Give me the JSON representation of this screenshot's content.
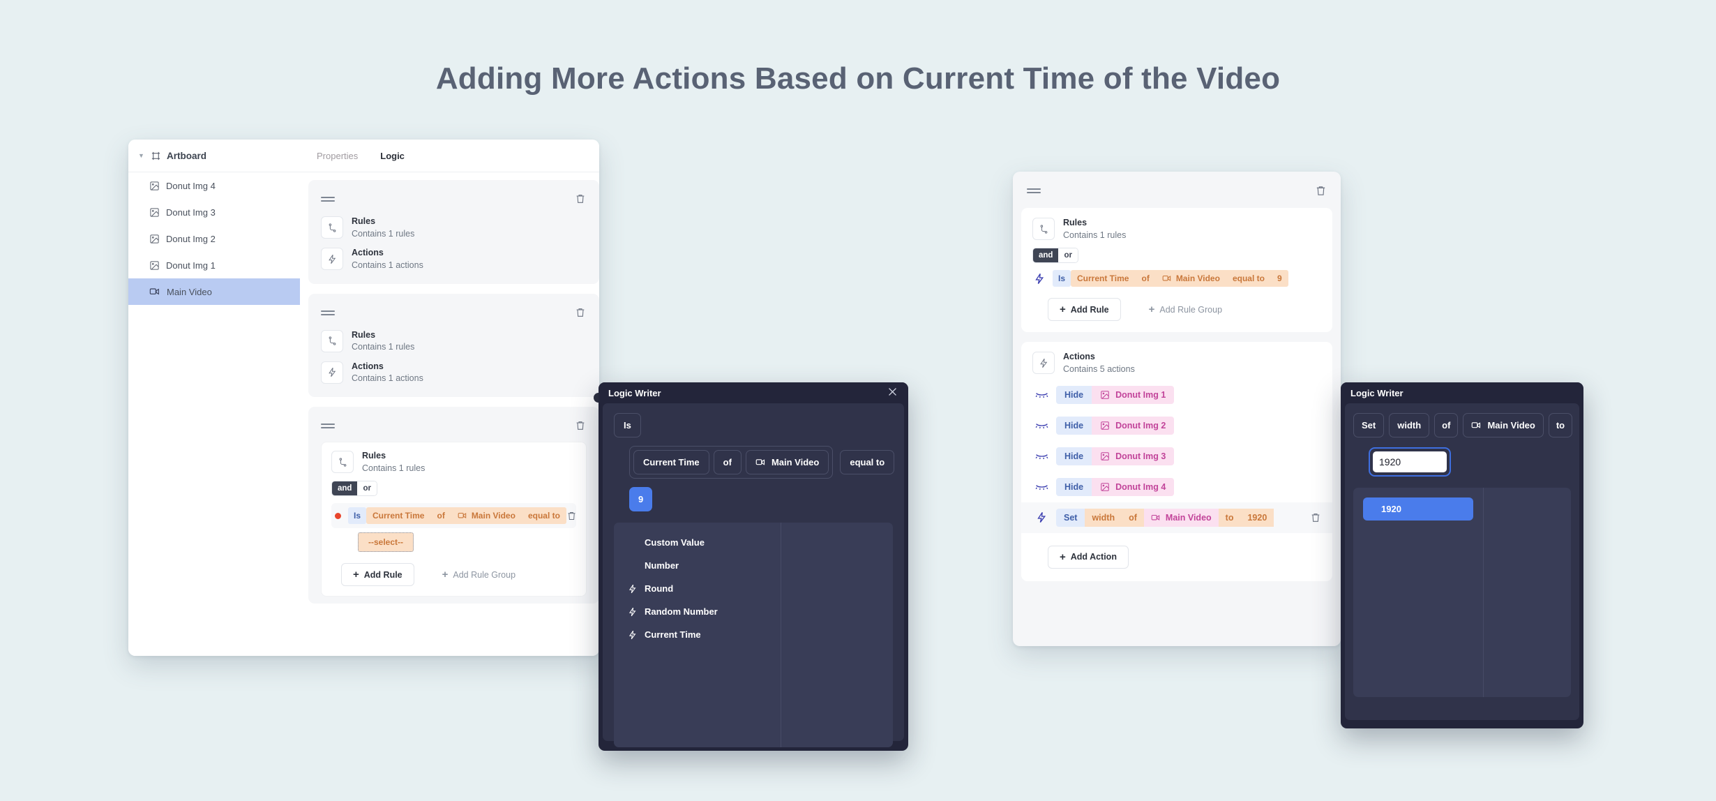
{
  "page": {
    "title": "Adding More Actions Based on Current Time of the Video",
    "background_color": "#e7f0f2",
    "title_color": "#596274"
  },
  "left_app": {
    "tree": {
      "header_label": "Artboard",
      "items": [
        {
          "label": "Donut Img 4",
          "icon": "image-icon",
          "selected": false
        },
        {
          "label": "Donut Img 3",
          "icon": "image-icon",
          "selected": false
        },
        {
          "label": "Donut Img 2",
          "icon": "image-icon",
          "selected": false
        },
        {
          "label": "Donut Img 1",
          "icon": "image-icon",
          "selected": false
        },
        {
          "label": "Main Video",
          "icon": "video-icon",
          "selected": true
        }
      ]
    },
    "tabs": [
      {
        "label": "Properties",
        "active": false
      },
      {
        "label": "Logic",
        "active": true
      }
    ],
    "cards": [
      {
        "rules_title": "Rules",
        "rules_sub": "Contains 1 rules",
        "actions_title": "Actions",
        "actions_sub": "Contains 1 actions"
      },
      {
        "rules_title": "Rules",
        "rules_sub": "Contains 1 rules",
        "actions_title": "Actions",
        "actions_sub": "Contains 1 actions"
      }
    ],
    "expanded_card": {
      "rules_title": "Rules",
      "rules_sub": "Contains 1 rules",
      "operator_and": "and",
      "operator_or": "or",
      "rule": {
        "is": "Is",
        "property": "Current Time",
        "of": "of",
        "target": "Main Video",
        "comparator": "equal to",
        "value_placeholder": "--select--"
      },
      "add_rule": "Add Rule",
      "add_rule_group": "Add Rule Group"
    }
  },
  "right_app": {
    "rules": {
      "title": "Rules",
      "sub": "Contains 1 rules",
      "operator_and": "and",
      "operator_or": "or",
      "rule": {
        "is": "Is",
        "property": "Current Time",
        "of": "of",
        "target": "Main Video",
        "comparator": "equal to",
        "value": "9"
      },
      "add_rule": "Add Rule",
      "add_rule_group": "Add Rule Group"
    },
    "actions": {
      "title": "Actions",
      "sub": "Contains 5 actions",
      "items": [
        {
          "verb": "Hide",
          "target": "Donut Img 1",
          "icon": "eye-closed-icon",
          "target_icon": "image-icon",
          "kind": "hide"
        },
        {
          "verb": "Hide",
          "target": "Donut Img 2",
          "icon": "eye-closed-icon",
          "target_icon": "image-icon",
          "kind": "hide"
        },
        {
          "verb": "Hide",
          "target": "Donut Img 3",
          "icon": "eye-closed-icon",
          "target_icon": "image-icon",
          "kind": "hide"
        },
        {
          "verb": "Hide",
          "target": "Donut Img 4",
          "icon": "eye-closed-icon",
          "target_icon": "image-icon",
          "kind": "hide"
        }
      ],
      "set_action": {
        "verb": "Set",
        "property": "width",
        "of": "of",
        "target": "Main Video",
        "to": "to",
        "value": "1920",
        "icon": "bolt-icon",
        "target_icon": "video-icon"
      },
      "add_action": "Add Action"
    }
  },
  "modal_center": {
    "title": "Logic Writer",
    "close_icon": "close-icon",
    "is_token": "Is",
    "tokens": [
      {
        "label": "Current Time",
        "icon": null
      },
      {
        "label": "of",
        "icon": null
      },
      {
        "label": "Main Video",
        "icon": "video-icon"
      }
    ],
    "comparator": "equal to",
    "value": "9",
    "dropdown": [
      {
        "label": "Custom Value",
        "icon": null
      },
      {
        "label": "Number",
        "icon": null
      },
      {
        "label": "Round",
        "icon": "bolt-icon"
      },
      {
        "label": "Random Number",
        "icon": "bolt-icon"
      },
      {
        "label": "Current Time",
        "icon": "bolt-icon"
      }
    ]
  },
  "modal_right": {
    "title": "Logic Writer",
    "tokens": [
      {
        "label": "Set",
        "icon": null
      },
      {
        "label": "width",
        "icon": null
      },
      {
        "label": "of",
        "icon": null
      },
      {
        "label": "Main Video",
        "icon": "video-icon"
      },
      {
        "label": "to",
        "icon": null
      }
    ],
    "input_value": "1920",
    "dropdown_selected": "1920"
  },
  "colors": {
    "accent_blue": "#4a7ceb",
    "orange_chip_bg": "#fbdfc6",
    "orange_chip_text": "#c9773a",
    "blue_chip_bg": "#e2ebfb",
    "blue_chip_text": "#3f5fa8",
    "pink_chip_bg": "#fbe0f0",
    "pink_chip_text": "#c2449a",
    "dark_modal": "#23253a",
    "dark_modal_body": "#30334a",
    "selected_tree_row": "#b9cbf2"
  }
}
